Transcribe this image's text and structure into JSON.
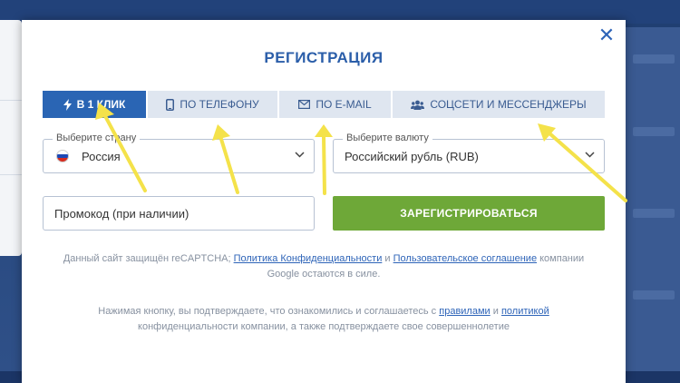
{
  "modal": {
    "close_glyph": "✕",
    "title": "РЕГИСТРАЦИЯ"
  },
  "tabs": [
    {
      "label": "В 1 КЛИК",
      "icon": "lightning-icon",
      "active": true
    },
    {
      "label": "ПО ТЕЛЕФОНУ",
      "icon": "phone-icon",
      "active": false
    },
    {
      "label": "ПО E-MAIL",
      "icon": "envelope-icon",
      "active": false
    },
    {
      "label": "СОЦСЕТИ И МЕССЕНДЖЕРЫ",
      "icon": "users-icon",
      "active": false
    }
  ],
  "country": {
    "legend": "Выберите страну",
    "value": "Россия"
  },
  "currency": {
    "legend": "Выберите валюту",
    "value": "Российский рубль (RUB)"
  },
  "promo": {
    "placeholder": "Промокод (при наличии)"
  },
  "register_label": "ЗАРЕГИСТРИРОВАТЬСЯ",
  "recaptcha": {
    "text1": "Данный сайт защищён reCAPTCHA; ",
    "link1": "Политика Конфиденциальности",
    "and1": " и ",
    "link2": "Пользовательское соглашение",
    "text2": " компании",
    "text3": "Google остаются в силе."
  },
  "consent": {
    "text1": "Нажимая кнопку, вы подтверждаете, что ознакомились и соглашаетесь с ",
    "link1": "правилами",
    "and1": " и ",
    "link2": "политикой",
    "text2": "конфиденциальности компании, а также подтверждаете свое совершеннолетие"
  },
  "colors": {
    "accent_blue": "#2a65b4",
    "register_green": "#6ea838",
    "arrow_yellow": "#f4e24a"
  }
}
